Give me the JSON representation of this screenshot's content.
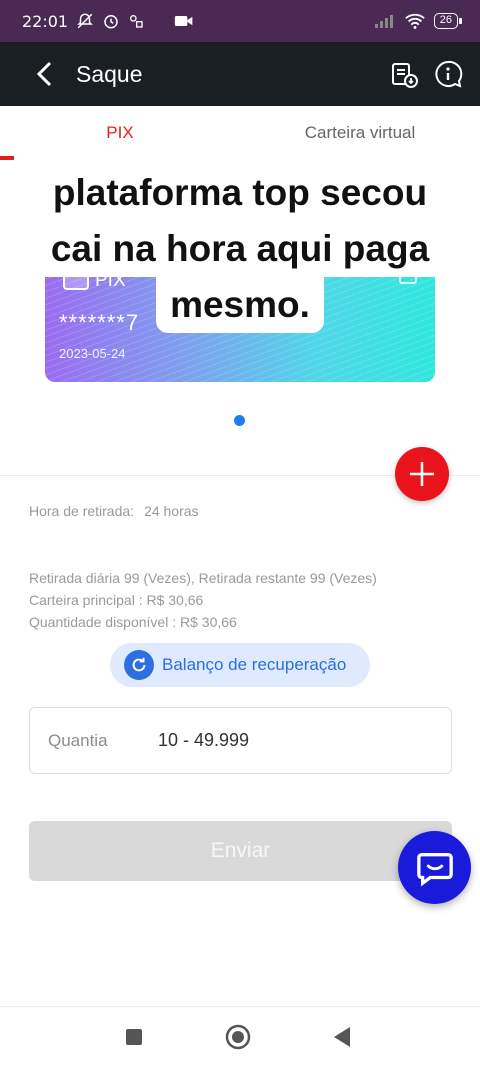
{
  "status_bar": {
    "time": "22:01",
    "battery": "26",
    "icons": [
      "mute-bell-icon",
      "alarm-icon",
      "app-icon",
      "camera-icon",
      "signal-icon",
      "wifi-icon",
      "battery-icon"
    ]
  },
  "app_bar": {
    "title": "Saque",
    "actions": [
      "records-icon",
      "help-chat-icon"
    ]
  },
  "tabs": [
    {
      "label": "PIX",
      "active": true
    },
    {
      "label": "Carteira virtual",
      "active": false
    }
  ],
  "card": {
    "brand": "PIX",
    "number": "*******7",
    "date": "2023-05-24"
  },
  "caption": {
    "line1": "plataforma top secou",
    "line2": "cai na hora aqui paga",
    "line3": "mesmo."
  },
  "withdraw_time": {
    "label": "Hora de retirada:",
    "value": "24 horas"
  },
  "limits": {
    "daily": "Retirada diária 99 (Vezes), Retirada restante 99 (Vezes)",
    "main_wallet": "Carteira principal : R$ 30,66",
    "available": "Quantidade disponível : R$ 30,66"
  },
  "recover_button": {
    "label": "Balanço de recuperação"
  },
  "amount": {
    "label": "Quantia",
    "placeholder": "10 - 49.999"
  },
  "submit_button": {
    "label": "Enviar"
  },
  "colors": {
    "accent_red": "#e02020",
    "app_bar": "#1a1f24",
    "status_bar": "#4a2a55",
    "chat_blue": "#1a1adb",
    "link_blue": "#2c6fdc"
  }
}
